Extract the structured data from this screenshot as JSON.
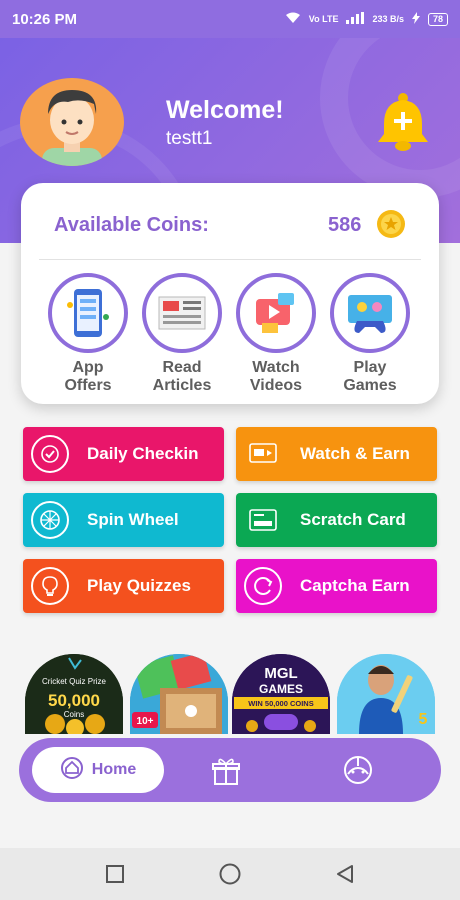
{
  "status_bar": {
    "time": "10:26 PM",
    "network": "Vo LTE",
    "speed": "233 B/s",
    "battery": "78"
  },
  "header": {
    "welcome": "Welcome!",
    "username": "testt1"
  },
  "coins": {
    "label": "Available Coins:",
    "value": "586"
  },
  "categories": [
    {
      "line1": "App",
      "line2": "Offers"
    },
    {
      "line1": "Read",
      "line2": "Articles"
    },
    {
      "line1": "Watch",
      "line2": "Videos"
    },
    {
      "line1": "Play",
      "line2": "Games"
    }
  ],
  "actions": [
    {
      "label": "Daily Checkin",
      "color": "#e9166a"
    },
    {
      "label": "Watch & Earn",
      "color": "#f7930f"
    },
    {
      "label": "Spin Wheel",
      "color": "#0fb9d0"
    },
    {
      "label": "Scratch Card",
      "color": "#0ba853"
    },
    {
      "label": "Play Quizzes",
      "color": "#f4511e"
    },
    {
      "label": "Captcha Earn",
      "color": "#e912c9"
    }
  ],
  "banners": {
    "quiz_title": "Cricket Quiz Prize",
    "quiz_amount": "50,000",
    "quiz_unit": "Coins",
    "ludo_badge": "10+",
    "mgl_title": "MGL",
    "mgl_sub": "GAMES",
    "mgl_win": "WIN 50,000 COINS"
  },
  "nav": {
    "home_label": "Home"
  },
  "colors": {
    "accent": "#8e6ddb",
    "header": "#7b62e4",
    "coin_text": "#8a62cf"
  }
}
